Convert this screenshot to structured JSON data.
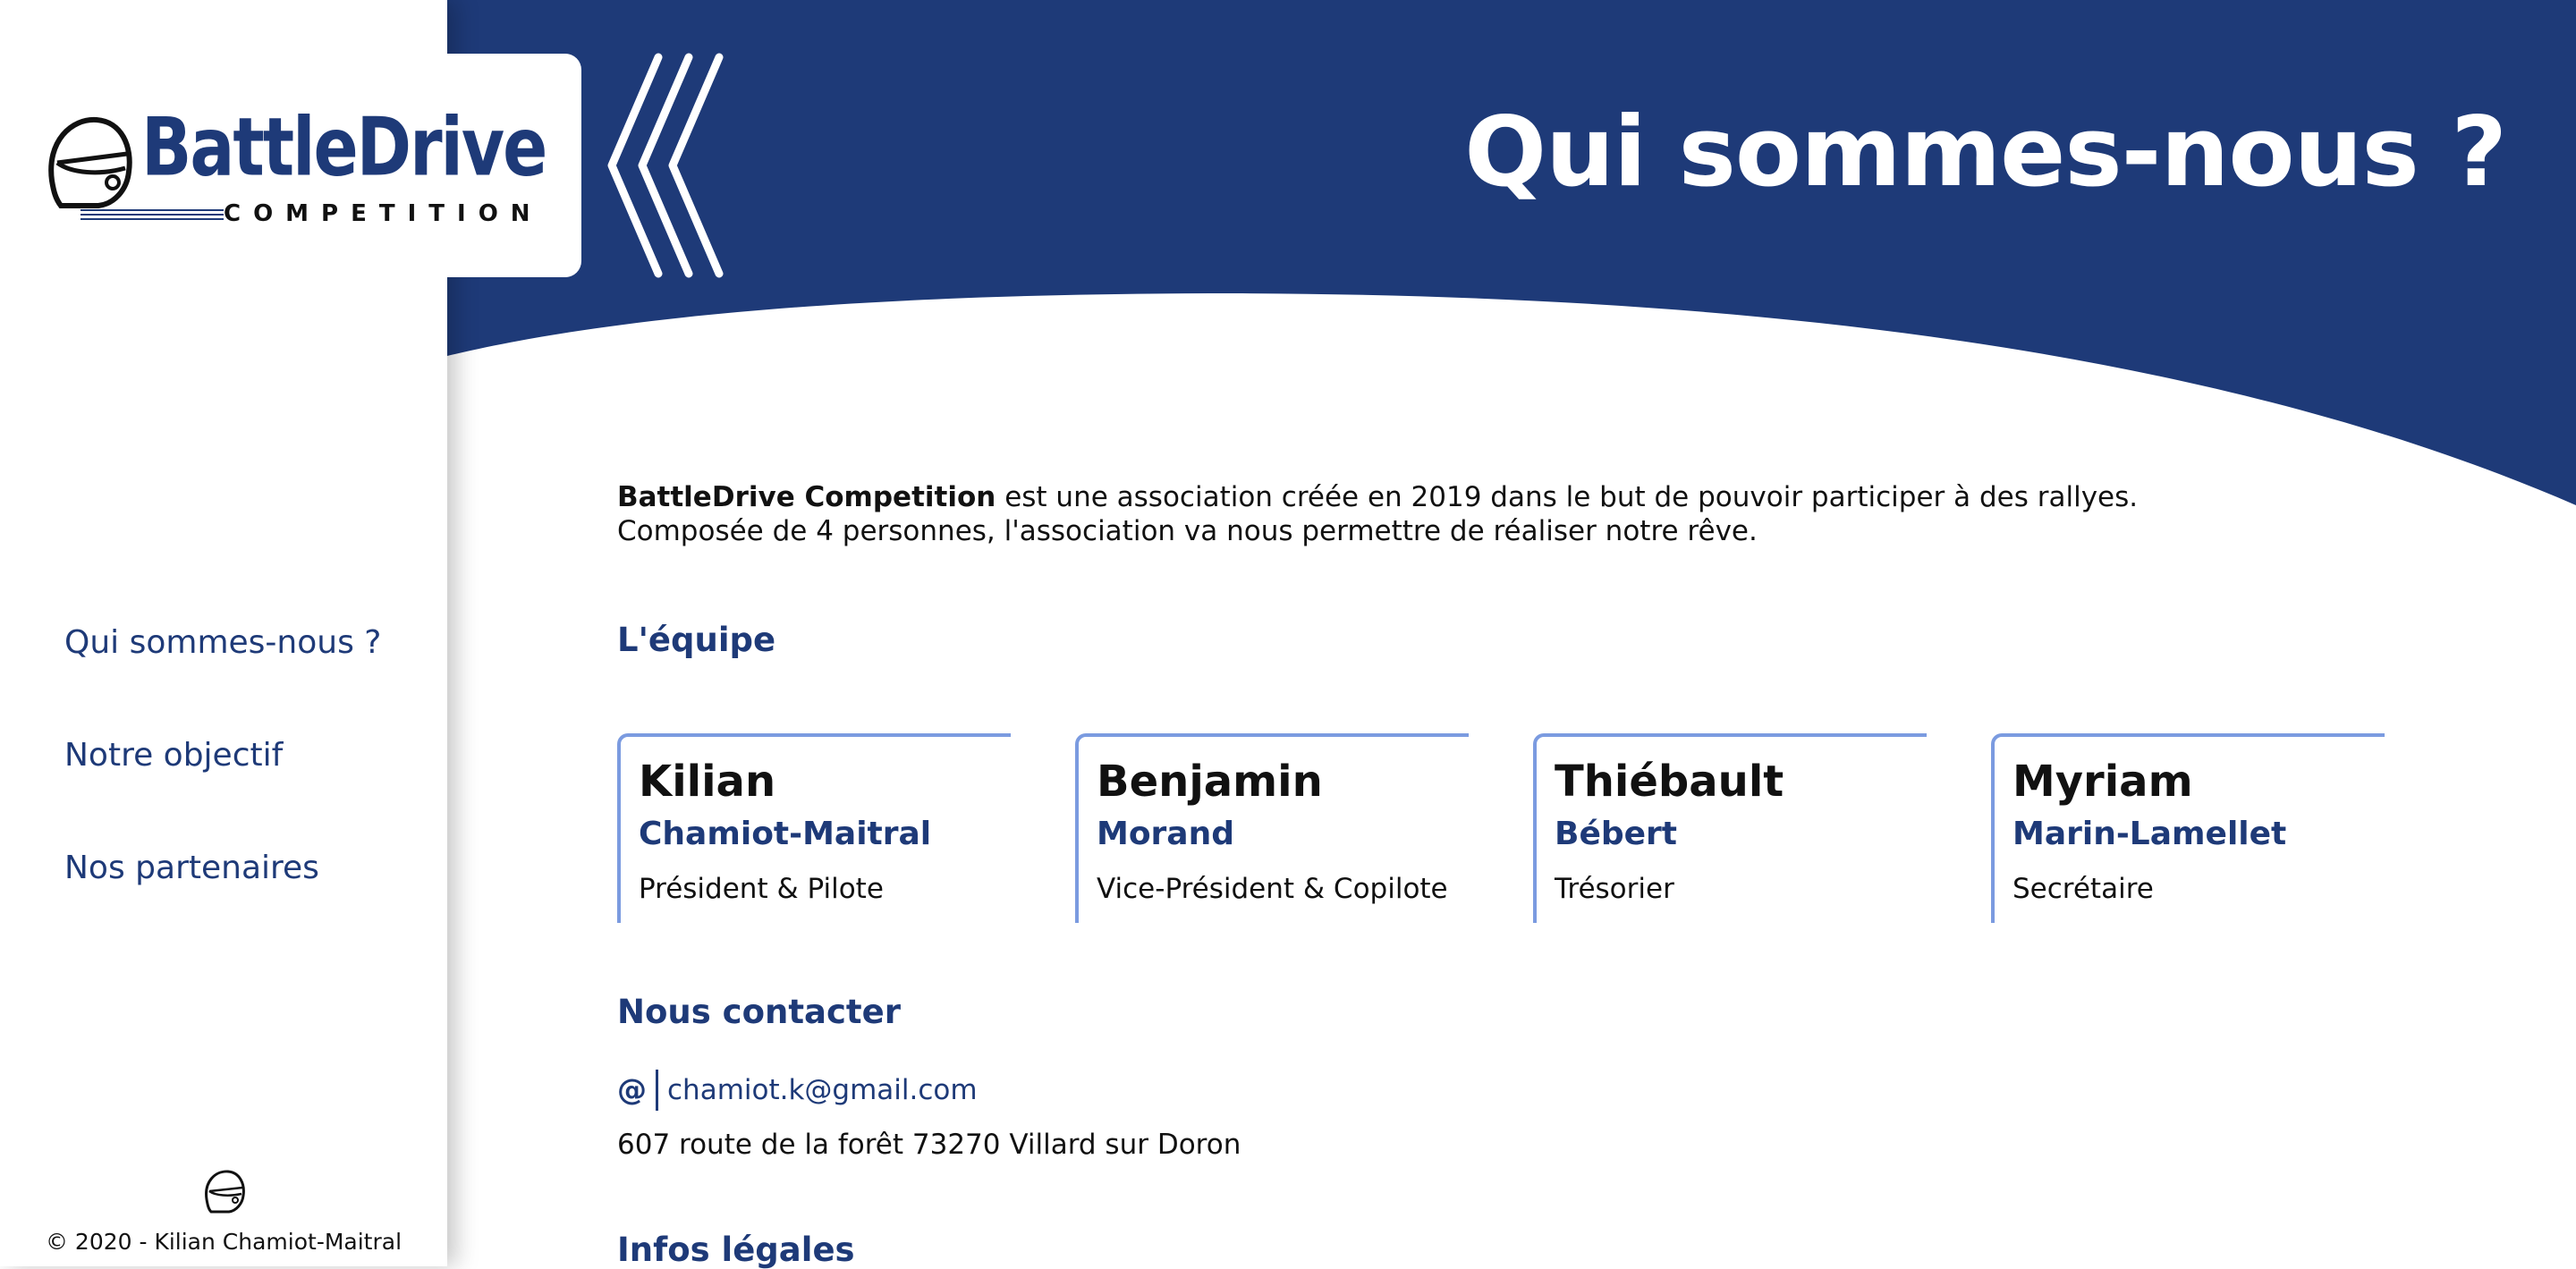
{
  "brand": {
    "name_top": "BattleDrive",
    "name_bottom": "COMPETITION",
    "primary_color": "#1e3a78",
    "accent_color": "#7b9be0"
  },
  "header": {
    "title": "Qui sommes-nous ?"
  },
  "nav": {
    "items": [
      {
        "label": "Qui sommes-nous ?"
      },
      {
        "label": "Notre objectif"
      },
      {
        "label": "Nos partenaires"
      }
    ]
  },
  "intro": {
    "strong": "BattleDrive Competition",
    "line1_rest": " est une association créée en 2019 dans le but de pouvoir participer à des rallyes.",
    "line2": "Composée de 4 personnes, l'association va nous permettre de réaliser notre rêve."
  },
  "team": {
    "heading": "L'équipe",
    "members": [
      {
        "first": "Kilian",
        "last": "Chamiot-Maitral",
        "role": "Président & Pilote"
      },
      {
        "first": "Benjamin",
        "last": "Morand",
        "role": "Vice-Président & Copilote"
      },
      {
        "first": "Thiébault",
        "last": "Bébert",
        "role": "Trésorier"
      },
      {
        "first": "Myriam",
        "last": "Marin-Lamellet",
        "role": "Secrétaire"
      }
    ]
  },
  "contact": {
    "heading": "Nous contacter",
    "at_symbol": "@",
    "email": "chamiot.k@gmail.com",
    "address": "607 route de la forêt 73270 Villard sur Doron"
  },
  "legal": {
    "heading": "Infos légales"
  },
  "footer": {
    "copyright": "© 2020 - Kilian Chamiot-Maitral"
  },
  "icons": {
    "logo": "helmet-icon",
    "header_decoration": "chevron-left-icon",
    "footer": "helmet-icon"
  }
}
